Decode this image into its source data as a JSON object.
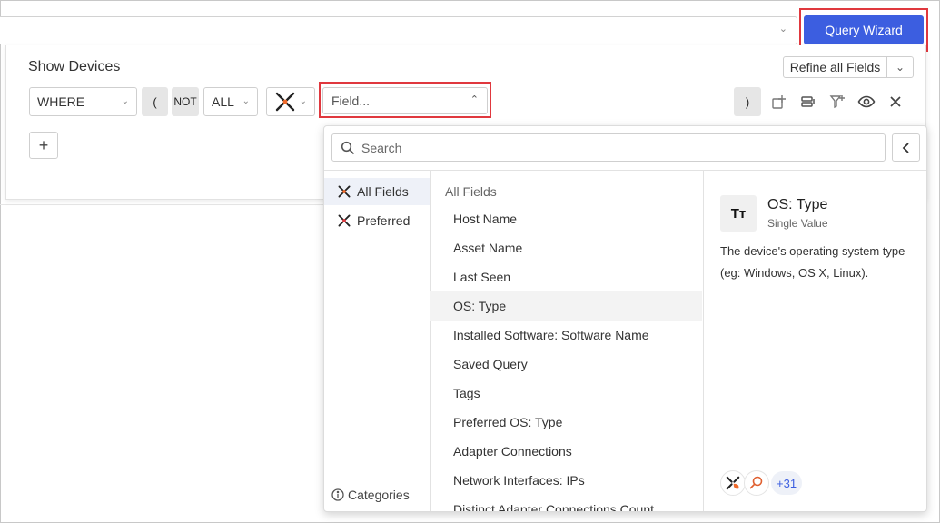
{
  "toolbar": {
    "query_wizard_label": "Query Wizard"
  },
  "panel": {
    "title": "Show Devices",
    "refine_label": "Refine all Fields",
    "where_value": "WHERE",
    "open_paren": "(",
    "not_label": "NOT",
    "all_value": "ALL",
    "field_placeholder": "Field...",
    "close_paren": ")",
    "add_label": "+"
  },
  "dropdown": {
    "search_placeholder": "Search",
    "categories": [
      {
        "label": "All Fields",
        "active": true
      },
      {
        "label": "Preferred",
        "active": false
      }
    ],
    "categories_link": "Categories",
    "fields_header": "All Fields",
    "fields": [
      "Host Name",
      "Asset Name",
      "Last Seen",
      "OS: Type",
      "Installed Software: Software Name",
      "Saved Query",
      "Tags",
      "Preferred OS: Type",
      "Adapter Connections",
      "Network Interfaces: IPs",
      "Distinct Adapter Connections Count"
    ],
    "detail": {
      "icon_text": "Tт",
      "title": "OS: Type",
      "subtitle": "Single Value",
      "description": "The device's operating system type (eg: Windows, OS X, Linux).",
      "more_adapters": "+31"
    }
  },
  "colors": {
    "accent": "#3c5ee0",
    "highlight": "#e0383e",
    "axonius_orange": "#f06a2a"
  }
}
